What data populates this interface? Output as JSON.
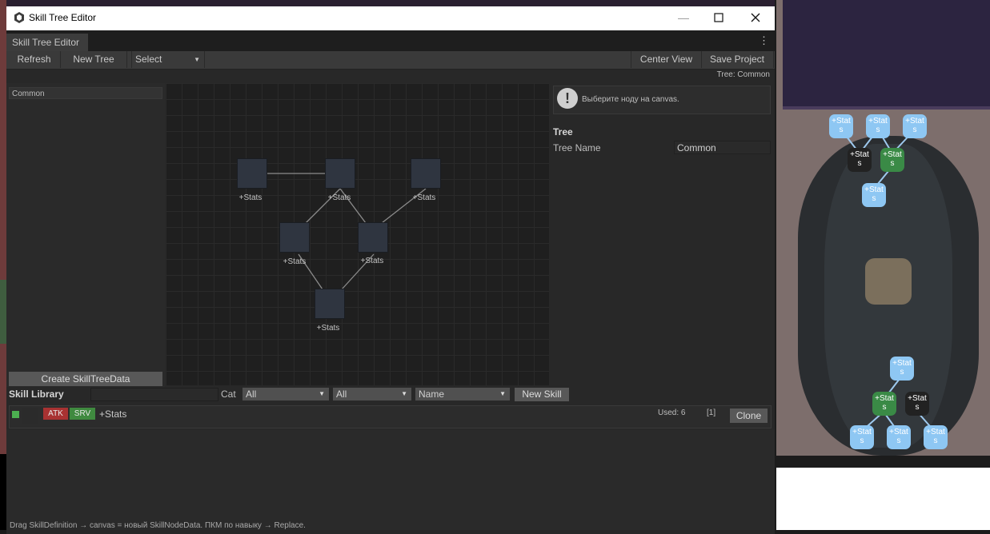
{
  "window": {
    "title": "Skill Tree Editor"
  },
  "tab": {
    "label": "Skill Tree Editor"
  },
  "toolbar": {
    "refresh": "Refresh",
    "new_tree": "New Tree",
    "select": "Select",
    "center_view": "Center View",
    "save_project": "Save Project"
  },
  "status": {
    "tree": "Tree: Common"
  },
  "tree_list": {
    "items": [
      "Common"
    ],
    "create_button": "Create SkillTreeData"
  },
  "canvas": {
    "node_labels": [
      "+Stats",
      "+Stats",
      "+Stats",
      "+Stats",
      "+Stats",
      "+Stats"
    ]
  },
  "inspector": {
    "hint": "Выберите ноду на canvas.",
    "heading": "Tree",
    "tree_name_label": "Tree Name",
    "tree_name_value": "Common"
  },
  "library": {
    "title": "Skill Library",
    "search_value": "",
    "cat_label": "Cat",
    "filter1": "All",
    "filter2": "All",
    "sort": "Name",
    "new_skill": "New Skill",
    "rows": [
      {
        "tag1": "ATK",
        "tag2": "SRV",
        "name": "+Stats",
        "used": "Used: 6",
        "count": "[1]",
        "clone": "Clone"
      }
    ]
  },
  "footer": {
    "text": "Drag SkillDefinition → canvas = новый SkillNodeData.  ПКМ по навыку → Replace."
  },
  "game_preview": {
    "top_nodes": [
      "+Stat s",
      "+Stat s",
      "+Stat s",
      "+Stat s",
      "+Stat s",
      "+Stat s"
    ],
    "bottom_nodes": [
      "+Stat s",
      "+Stat s",
      "+Stat s",
      "+Stat s",
      "+Stat s",
      "+Stat s"
    ]
  },
  "colors": {
    "accent_green": "#4caf50",
    "atk_red": "#a83232",
    "srv_green": "#3f8a3f",
    "game_node_blue": "#8ec7f3"
  }
}
